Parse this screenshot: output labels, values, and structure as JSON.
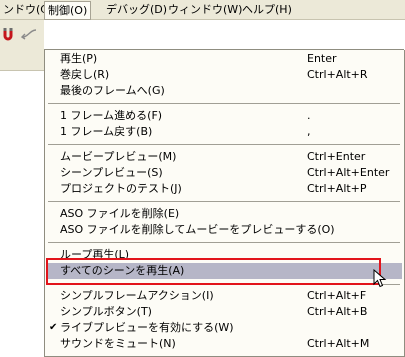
{
  "menubar": {
    "items": [
      {
        "label": "ンドウ(C)"
      },
      {
        "label": "制御(O)"
      },
      {
        "label": "デバッグ(D)"
      },
      {
        "label": "ウィンドウ(W)"
      },
      {
        "label": "ヘルプ(H)"
      }
    ]
  },
  "menu": {
    "items": [
      {
        "label": "再生(P)",
        "shortcut": "Enter"
      },
      {
        "label": "巻戻し(R)",
        "shortcut": "Ctrl+Alt+R"
      },
      {
        "label": "最後のフレームへ(G)",
        "shortcut": ""
      },
      {
        "label": "1 フレーム進める(F)",
        "shortcut": "."
      },
      {
        "label": "1 フレーム戻す(B)",
        "shortcut": ","
      },
      {
        "label": "ムービープレビュー(M)",
        "shortcut": "Ctrl+Enter"
      },
      {
        "label": "シーンプレビュー(S)",
        "shortcut": "Ctrl+Alt+Enter"
      },
      {
        "label": "プロジェクトのテスト(J)",
        "shortcut": "Ctrl+Alt+P"
      },
      {
        "label": "ASO ファイルを削除(E)",
        "shortcut": ""
      },
      {
        "label": "ASO ファイルを削除してムービーをプレビューする(O)",
        "shortcut": ""
      },
      {
        "label": "ループ再生(L)",
        "shortcut": ""
      },
      {
        "label": "すべてのシーンを再生(A)",
        "shortcut": ""
      },
      {
        "label": "シンプルフレームアクション(I)",
        "shortcut": "Ctrl+Alt+F"
      },
      {
        "label": "シンプルボタン(T)",
        "shortcut": "Ctrl+Alt+B"
      },
      {
        "label": "ライブプレビューを有効にする(W)",
        "shortcut": "",
        "checked": true
      },
      {
        "label": "サウンドをミュート(N)",
        "shortcut": "Ctrl+Alt+M"
      }
    ],
    "check_mark": "✔"
  },
  "colors": {
    "highlight": "#b6b6c7",
    "annotation": "#e2141b",
    "menu_bg": "#fdfcf6"
  }
}
